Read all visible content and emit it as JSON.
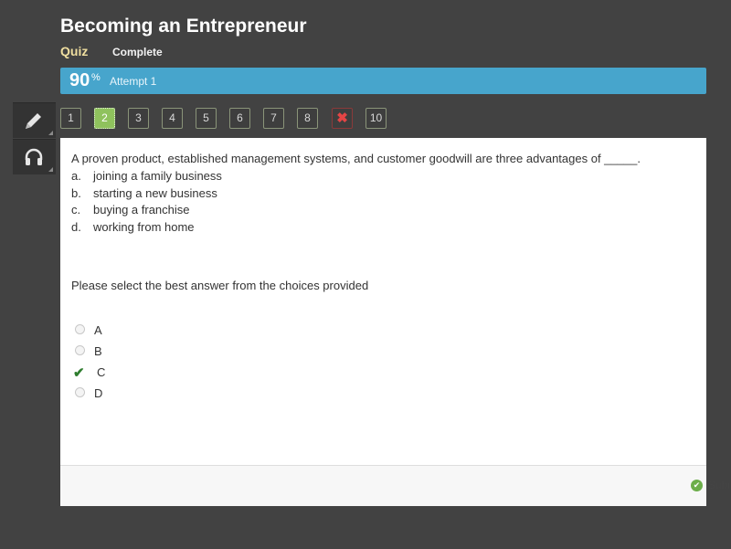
{
  "header": {
    "title": "Becoming an Entrepreneur",
    "type_label": "Quiz",
    "status_label": "Complete"
  },
  "score": {
    "value": "90",
    "unit": "%",
    "attempt": "Attempt 1"
  },
  "tools": [
    {
      "name": "pencil-icon"
    },
    {
      "name": "headphones-icon"
    }
  ],
  "question_nav": [
    {
      "label": "1",
      "state": "answered"
    },
    {
      "label": "2",
      "state": "current"
    },
    {
      "label": "3",
      "state": "answered"
    },
    {
      "label": "4",
      "state": "answered"
    },
    {
      "label": "5",
      "state": "answered"
    },
    {
      "label": "6",
      "state": "answered"
    },
    {
      "label": "7",
      "state": "answered"
    },
    {
      "label": "8",
      "state": "answered"
    },
    {
      "label": "✖",
      "state": "incorrect"
    },
    {
      "label": "10",
      "state": "answered"
    }
  ],
  "question": {
    "text": "A proven product, established management systems, and customer goodwill are three advantages of _____.",
    "choices": [
      {
        "letter": "a.",
        "text": "joining a family business"
      },
      {
        "letter": "b.",
        "text": "starting a new business"
      },
      {
        "letter": "c.",
        "text": "buying a franchise"
      },
      {
        "letter": "d.",
        "text": "working from home"
      }
    ],
    "prompt": "Please select the best answer from the choices provided"
  },
  "options": [
    {
      "label": "A",
      "selected": false
    },
    {
      "label": "B",
      "selected": false
    },
    {
      "label": "C",
      "selected": true
    },
    {
      "label": "D",
      "selected": false
    }
  ],
  "footer": {
    "status": "Submitted"
  },
  "colors": {
    "accent_blue": "#47a5cc",
    "correct_green": "#8fc25d",
    "incorrect_red": "#e54545"
  }
}
